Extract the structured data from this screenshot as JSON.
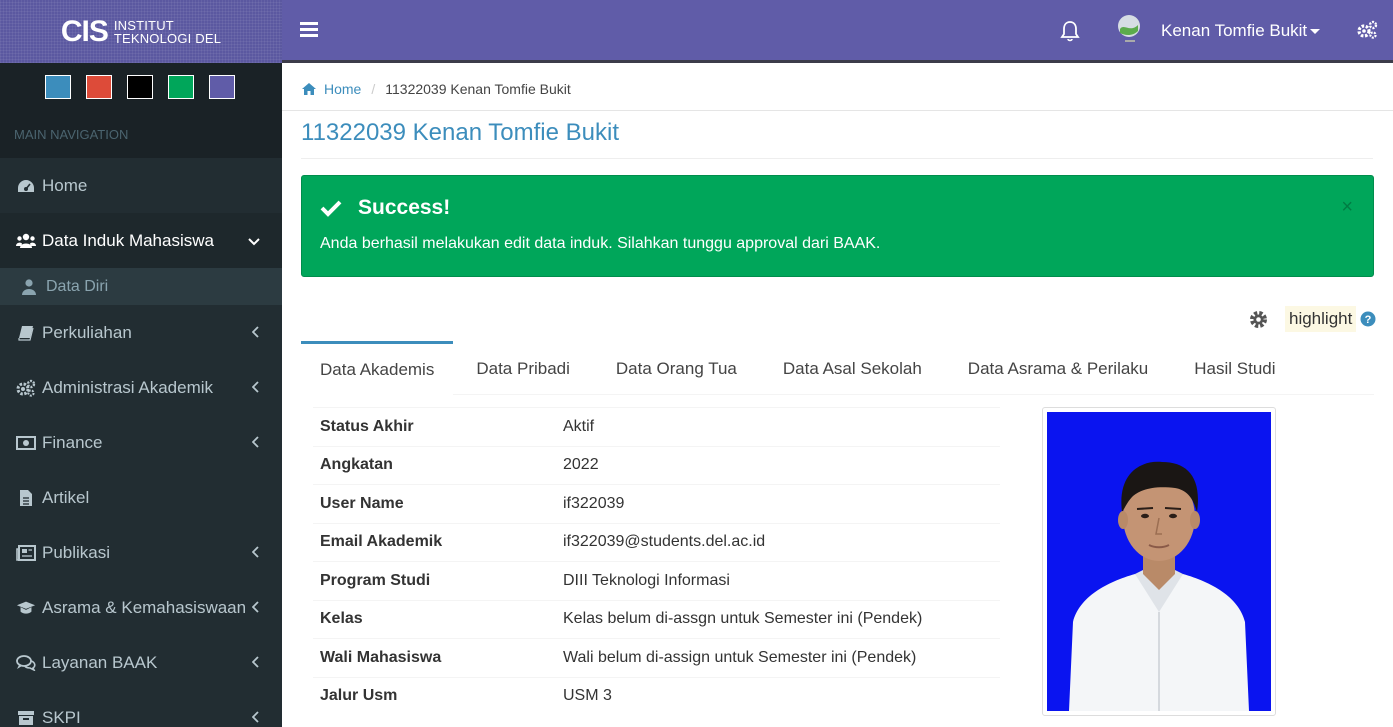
{
  "brand": {
    "mark": "CIS",
    "line1": "INSTITUT",
    "line2": "TEKNOLOGI DEL"
  },
  "skins": [
    "#3c8dbc",
    "#dd4b39",
    "#000000",
    "#00a65a",
    "#605ca8"
  ],
  "sidebar": {
    "header": "MAIN NAVIGATION",
    "items": [
      {
        "label": "Home",
        "icon": "dashboard-icon"
      },
      {
        "label": "Data Induk Mahasiswa",
        "icon": "users-icon"
      },
      {
        "label": "Data Diri",
        "icon": "user-icon"
      },
      {
        "label": "Perkuliahan",
        "icon": "book-icon"
      },
      {
        "label": "Administrasi Akademik",
        "icon": "cogs-icon"
      },
      {
        "label": "Finance",
        "icon": "money-icon"
      },
      {
        "label": "Artikel",
        "icon": "file-icon"
      },
      {
        "label": "Publikasi",
        "icon": "newspaper-icon"
      },
      {
        "label": "Asrama & Kemahasiswaan",
        "icon": "graduation-cap-icon"
      },
      {
        "label": "Layanan BAAK",
        "icon": "comments-icon"
      },
      {
        "label": "SKPI",
        "icon": "archive-icon"
      }
    ]
  },
  "header": {
    "username": "Kenan Tomfie Bukit"
  },
  "breadcrumb": {
    "home": "Home",
    "current": "11322039 Kenan Tomfie Bukit"
  },
  "page": {
    "title": "11322039 Kenan Tomfie Bukit"
  },
  "alert": {
    "title": "Success!",
    "message": "Anda berhasil melakukan edit data induk. Silahkan tunggu approval dari BAAK.",
    "close": "×"
  },
  "tools": {
    "highlight": "highlight"
  },
  "tabs": [
    "Data Akademis",
    "Data Pribadi",
    "Data Orang Tua",
    "Data Asal Sekolah",
    "Data Asrama & Perilaku",
    "Hasil Studi"
  ],
  "academic": [
    {
      "key": "Status Akhir",
      "value": "Aktif"
    },
    {
      "key": "Angkatan",
      "value": "2022"
    },
    {
      "key": "User Name",
      "value": "if322039"
    },
    {
      "key": "Email Akademik",
      "value": "if322039@students.del.ac.id"
    },
    {
      "key": "Program Studi",
      "value": "DIII Teknologi Informasi"
    },
    {
      "key": "Kelas",
      "value": "Kelas belum di-assgn untuk Semester ini (Pendek)"
    },
    {
      "key": "Wali Mahasiswa",
      "value": "Wali belum di-assign untuk Semester ini (Pendek)"
    },
    {
      "key": "Jalur Usm",
      "value": "USM 3"
    }
  ]
}
